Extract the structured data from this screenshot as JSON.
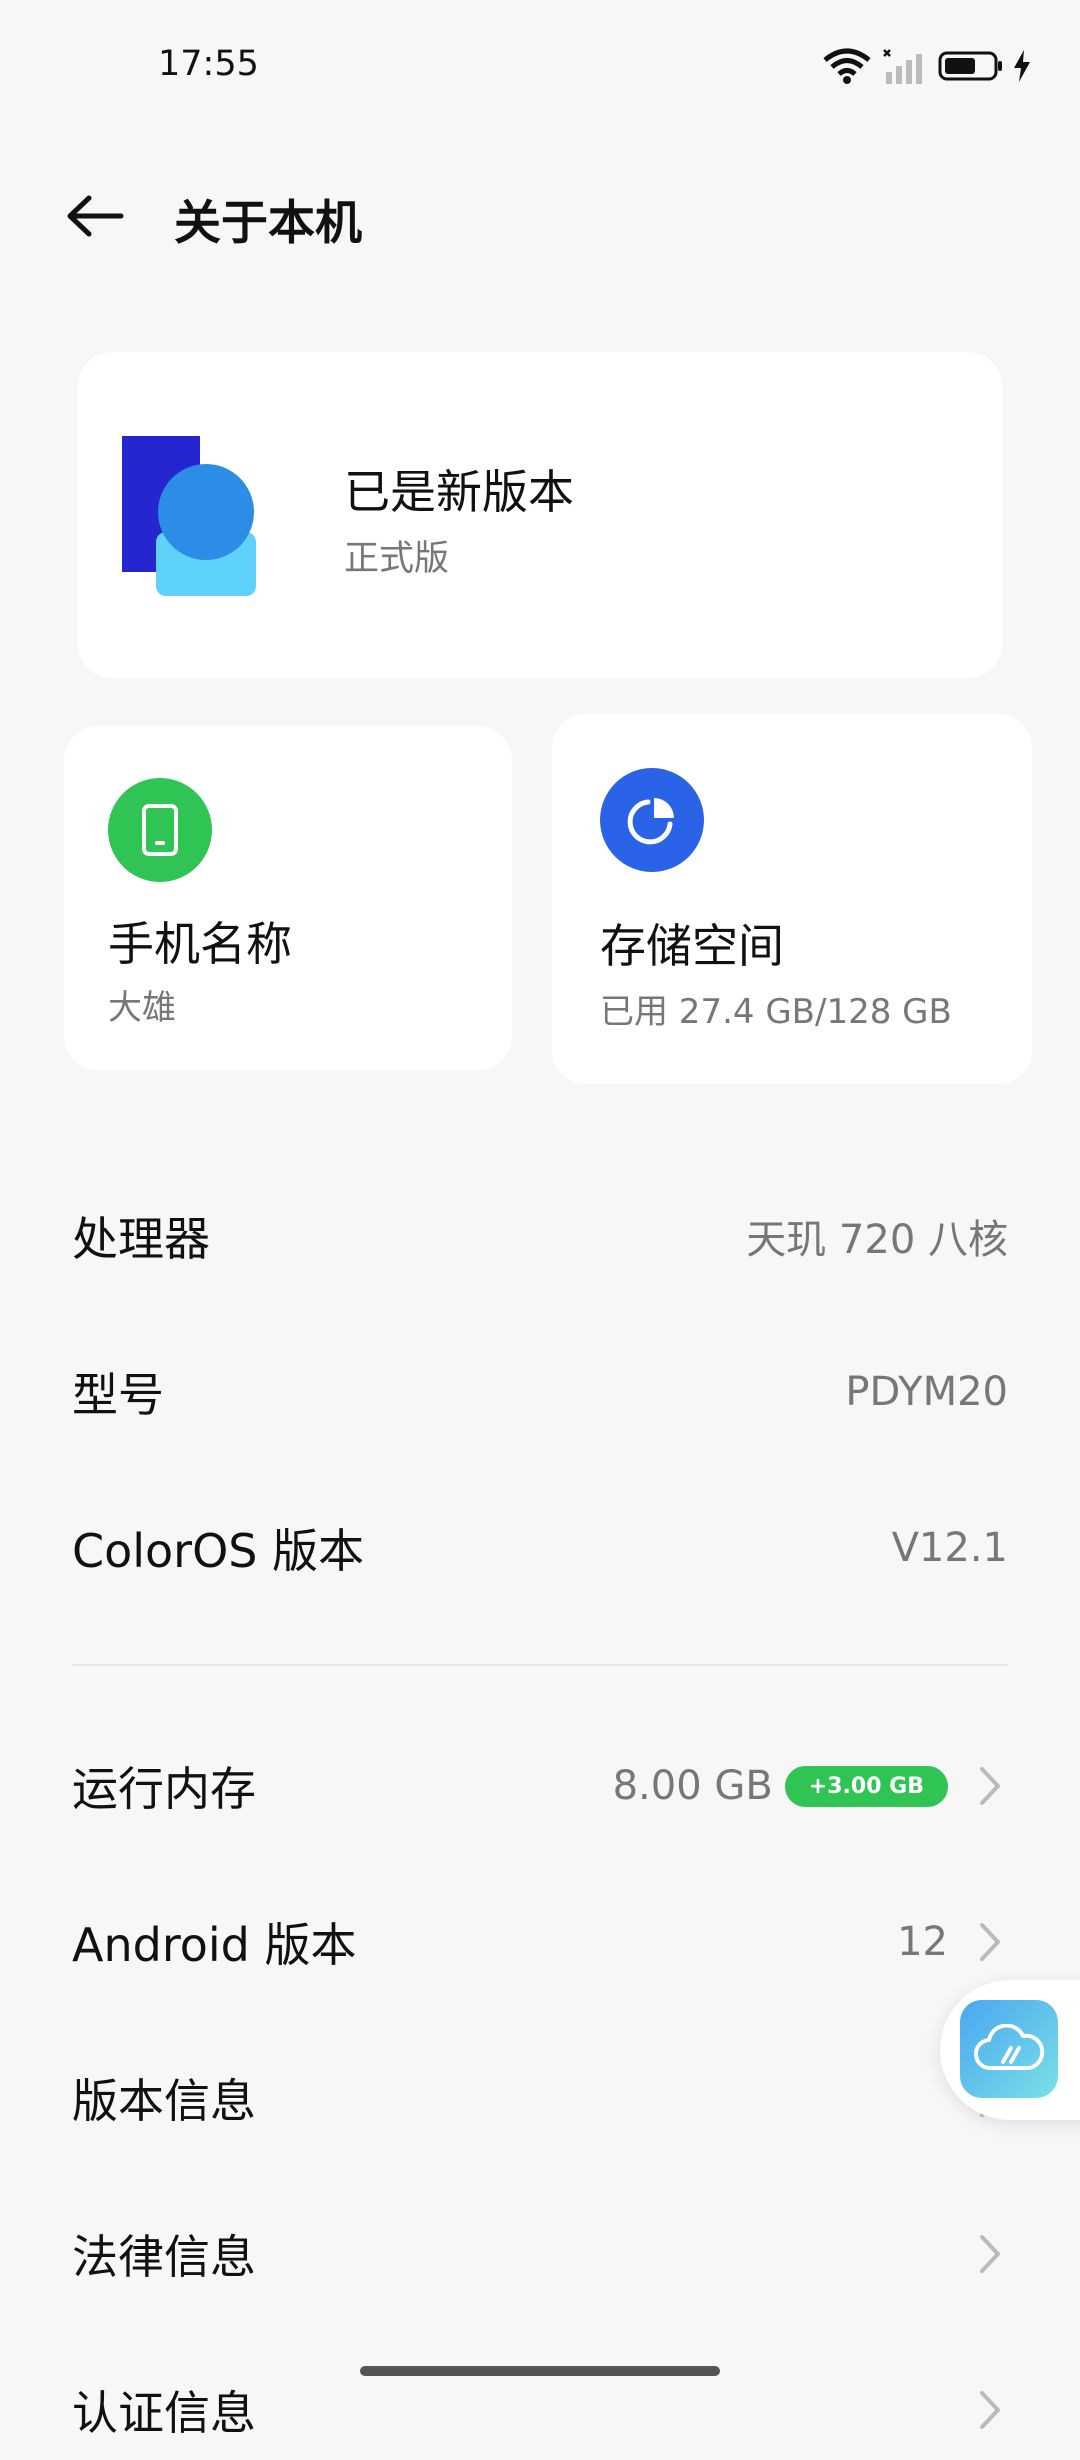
{
  "status_bar": {
    "time": "17:55"
  },
  "header": {
    "title": "关于本机"
  },
  "update_card": {
    "title": "已是新版本",
    "subtitle": "正式版"
  },
  "phone_name_card": {
    "title": "手机名称",
    "value": "大雄"
  },
  "storage_card": {
    "title": "存储空间",
    "value": "已用 27.4 GB/128 GB"
  },
  "specs": [
    {
      "label": "处理器",
      "value": "天玑 720 八核"
    },
    {
      "label": "型号",
      "value": "PDYM20"
    },
    {
      "label": "ColorOS 版本",
      "value": "V12.1"
    }
  ],
  "settings": [
    {
      "label": "运行内存",
      "value": "8.00 GB",
      "badge": "+3.00 GB"
    },
    {
      "label": "Android 版本",
      "value": "12"
    },
    {
      "label": "版本信息",
      "value": ""
    },
    {
      "label": "法律信息",
      "value": ""
    },
    {
      "label": "认证信息",
      "value": ""
    }
  ],
  "colors": {
    "green": "#30c455",
    "blue": "#2a62e8",
    "background": "#f7f7f7"
  },
  "icons": [
    "back-arrow-icon",
    "wifi-icon",
    "signal-icon",
    "battery-icon",
    "charging-icon",
    "phone-icon",
    "pie-chart-icon",
    "chevron-right-icon",
    "cloud-icon"
  ]
}
